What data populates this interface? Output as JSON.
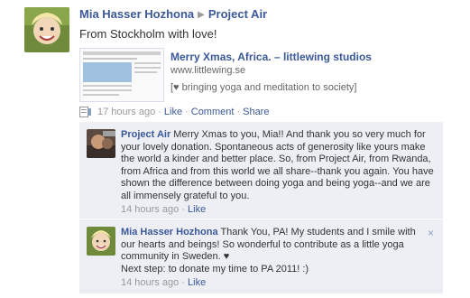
{
  "post": {
    "author": "Mia Hasser Hozhona",
    "target": "Project Air",
    "message": "From Stockholm with love!",
    "attachment": {
      "title": "Merry Xmas, Africa. – littlewing studios",
      "url": "www.littlewing.se",
      "description": "[♥ bringing yoga and meditation to society]"
    },
    "meta": {
      "time": "17 hours ago",
      "like": "Like",
      "comment": "Comment",
      "share": "Share",
      "sep": "·"
    }
  },
  "comments": [
    {
      "author": "Project Air",
      "text": "Merry Xmas to you, Mia!! And thank you so very much for your lovely donation. Spontaneous acts of generosity like yours make the world a kinder and better place. So, from Project Air, from Rwanda, from Africa and from this world we all share--thank you again. You have shown the difference between doing yoga and being yoga--and we are all immensely grateful to you.",
      "time": "14 hours ago",
      "like": "Like"
    },
    {
      "author": "Mia Hasser Hozhona",
      "text": "Thank You, PA! My students and I smile with our hearts and beings! So wonderful to contribute as a little yoga community in Sweden. ♥",
      "text2": "Next step: to donate my time to PA 2011! :)",
      "time": "14 hours ago",
      "like": "Like",
      "close": "×"
    }
  ],
  "icons": {
    "share_icon": "post-type-icon"
  },
  "colors": {
    "link": "#3b5998",
    "comment_bg": "#edeff4",
    "meta": "#999999"
  }
}
